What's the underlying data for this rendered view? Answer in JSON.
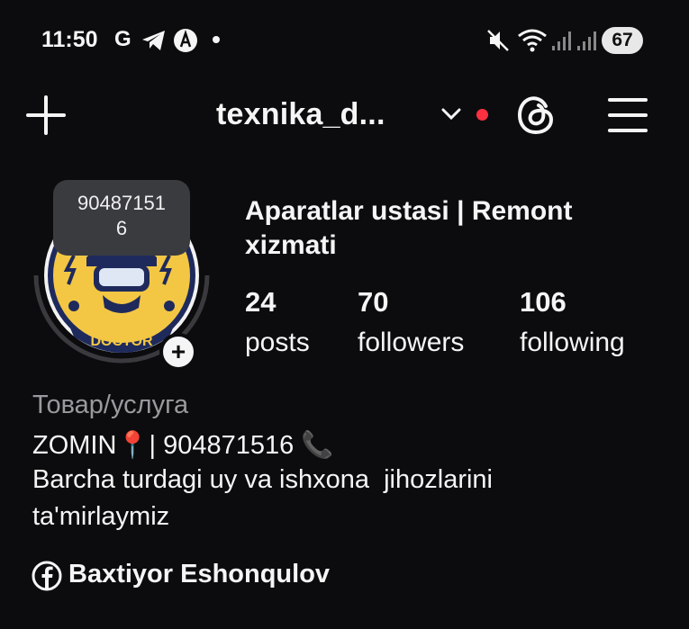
{
  "status_bar": {
    "time": "11:50",
    "g_icon_text": "G",
    "battery": "67"
  },
  "header": {
    "username": "texnika_d..."
  },
  "profile": {
    "avatar_tooltip": "90487151\n6",
    "display_name": "Aparatlar ustasi | Remont xizmati",
    "stats": [
      {
        "value": "24",
        "label": "posts"
      },
      {
        "value": "70",
        "label": "followers"
      },
      {
        "value": "106",
        "label": "following"
      }
    ],
    "category": "Товар/услуга",
    "bio_line1": "ZOMIN📍| 904871516 📞",
    "bio_line2": "Barcha turdagi uy va ishxona  jihozlarini",
    "bio_line3": "ta'mirlaymiz",
    "facebook_name": "Baxtiyor Eshonqulov",
    "logo_text": "DOCTOR"
  },
  "colors": {
    "background": "#0c0c0e",
    "notification_dot": "#ff3040",
    "category_text": "#9a9a9e",
    "logo_yellow": "#f3c744",
    "logo_navy": "#1f2a5c"
  }
}
